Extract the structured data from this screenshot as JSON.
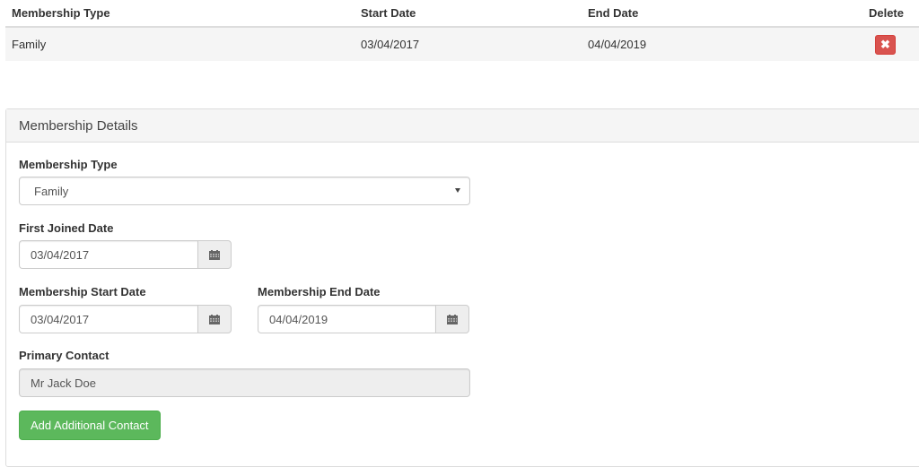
{
  "table": {
    "headers": {
      "membership_type": "Membership Type",
      "start_date": "Start Date",
      "end_date": "End Date",
      "delete": "Delete"
    },
    "rows": [
      {
        "membership_type": "Family",
        "start_date": "03/04/2017",
        "end_date": "04/04/2019",
        "delete_icon": "✖"
      }
    ]
  },
  "panel": {
    "title": "Membership Details",
    "membership_type": {
      "label": "Membership Type",
      "value": "Family"
    },
    "first_joined": {
      "label": "First Joined Date",
      "value": "03/04/2017",
      "icon": "calendar-icon"
    },
    "start_date": {
      "label": "Membership Start Date",
      "value": "03/04/2017",
      "icon": "calendar-icon"
    },
    "end_date": {
      "label": "Membership End Date",
      "value": "04/04/2019",
      "icon": "calendar-icon"
    },
    "primary_contact": {
      "label": "Primary Contact",
      "value": "Mr Jack Doe"
    },
    "add_contact_button": "Add Additional Contact"
  },
  "colors": {
    "danger": "#d9534f",
    "success": "#5cb85c",
    "panel_heading_bg": "#f5f5f5",
    "readonly_bg": "#eeeeee"
  }
}
